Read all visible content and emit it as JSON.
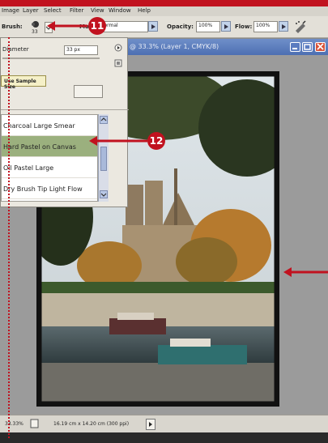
{
  "menubar": {
    "items": [
      "Image",
      "Layer",
      "Select",
      "Filter",
      "View",
      "Window",
      "Help"
    ]
  },
  "options_bar": {
    "brush_label": "Brush:",
    "brush_size": "33",
    "mode_label": "Mode:",
    "mode_value": "Normal",
    "opacity_label": "Opacity:",
    "opacity_value": "100%",
    "flow_label": "Flow:",
    "flow_value": "100%"
  },
  "document": {
    "title": "@ 33.3% (Layer 1, CMYK/8)",
    "zoom": "33.33%",
    "doc_size": "16.19 cm x 14.20 cm (300 ppi)"
  },
  "brush_panel": {
    "diameter_label": "Diameter",
    "diameter_value": "33 px",
    "sample_size_label": "Use Sample Size",
    "brushes": [
      "Charcoal Large Smear",
      "Hard Pastel on Canvas",
      "Oil Pastel Large",
      "Dry Brush Tip Light Flow"
    ],
    "selected_index": 1
  },
  "callouts": {
    "c11": "11",
    "c12": "12"
  },
  "colors": {
    "accent_red": "#c1121f",
    "selection": "#9bb07e"
  }
}
